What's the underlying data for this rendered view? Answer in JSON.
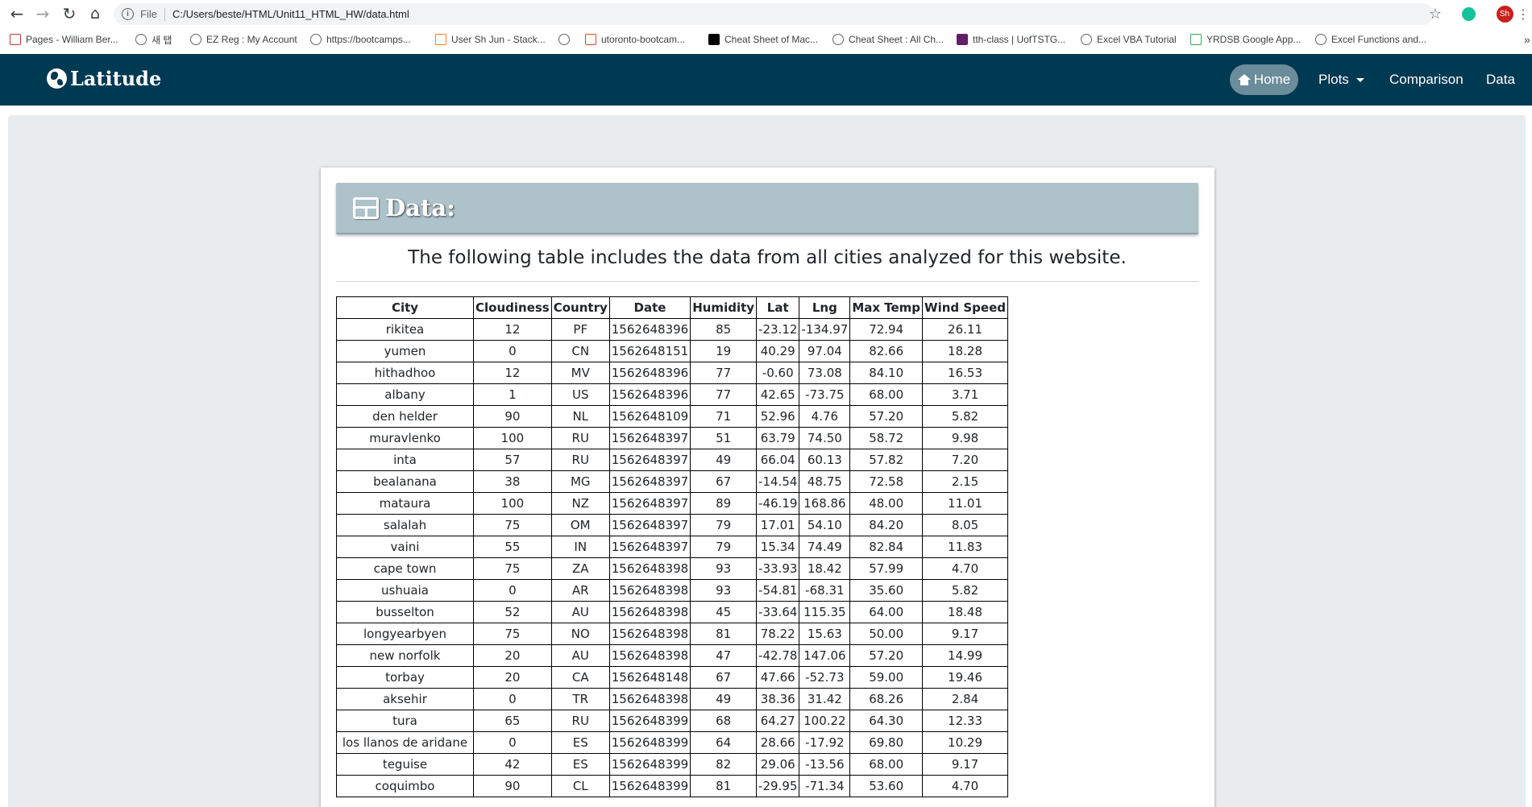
{
  "browser": {
    "address": {
      "scheme_label": "File",
      "url": "C:/Users/beste/HTML/Unit11_HTML_HW/data.html"
    },
    "profile_badge": "Sh",
    "bookmarks": [
      "Pages - William Ber...",
      "새 탭",
      "EZ Reg : My Account",
      "https://bootcamps...",
      "User Sh Jun - Stack...",
      "",
      "utoronto-bootcam...",
      "Cheat Sheet of Mac...",
      "Cheat Sheet : All Ch...",
      "tth-class | UofTSTG...",
      "Excel VBA Tutorial",
      "YRDSB Google App...",
      "Excel Functions and..."
    ],
    "bookmarks_overflow": "»"
  },
  "navbar": {
    "brand": "Latitude",
    "links": {
      "home": "Home",
      "plots": "Plots",
      "comparison": "Comparison",
      "data": "Data"
    }
  },
  "section": {
    "title": "Data:",
    "intro": "The following table includes the data from all cities analyzed for this website."
  },
  "table": {
    "headers": [
      "City",
      "Cloudiness",
      "Country",
      "Date",
      "Humidity",
      "Lat",
      "Lng",
      "Max Temp",
      "Wind Speed"
    ],
    "rows": [
      [
        "rikitea",
        "12",
        "PF",
        "1562648396",
        "85",
        "-23.12",
        "-134.97",
        "72.94",
        "26.11"
      ],
      [
        "yumen",
        "0",
        "CN",
        "1562648151",
        "19",
        "40.29",
        "97.04",
        "82.66",
        "18.28"
      ],
      [
        "hithadhoo",
        "12",
        "MV",
        "1562648396",
        "77",
        "-0.60",
        "73.08",
        "84.10",
        "16.53"
      ],
      [
        "albany",
        "1",
        "US",
        "1562648396",
        "77",
        "42.65",
        "-73.75",
        "68.00",
        "3.71"
      ],
      [
        "den helder",
        "90",
        "NL",
        "1562648109",
        "71",
        "52.96",
        "4.76",
        "57.20",
        "5.82"
      ],
      [
        "muravlenko",
        "100",
        "RU",
        "1562648397",
        "51",
        "63.79",
        "74.50",
        "58.72",
        "9.98"
      ],
      [
        "inta",
        "57",
        "RU",
        "1562648397",
        "49",
        "66.04",
        "60.13",
        "57.82",
        "7.20"
      ],
      [
        "bealanana",
        "38",
        "MG",
        "1562648397",
        "67",
        "-14.54",
        "48.75",
        "72.58",
        "2.15"
      ],
      [
        "mataura",
        "100",
        "NZ",
        "1562648397",
        "89",
        "-46.19",
        "168.86",
        "48.00",
        "11.01"
      ],
      [
        "salalah",
        "75",
        "OM",
        "1562648397",
        "79",
        "17.01",
        "54.10",
        "84.20",
        "8.05"
      ],
      [
        "vaini",
        "55",
        "IN",
        "1562648397",
        "79",
        "15.34",
        "74.49",
        "82.84",
        "11.83"
      ],
      [
        "cape town",
        "75",
        "ZA",
        "1562648398",
        "93",
        "-33.93",
        "18.42",
        "57.99",
        "4.70"
      ],
      [
        "ushuaia",
        "0",
        "AR",
        "1562648398",
        "93",
        "-54.81",
        "-68.31",
        "35.60",
        "5.82"
      ],
      [
        "busselton",
        "52",
        "AU",
        "1562648398",
        "45",
        "-33.64",
        "115.35",
        "64.00",
        "18.48"
      ],
      [
        "longyearbyen",
        "75",
        "NO",
        "1562648398",
        "81",
        "78.22",
        "15.63",
        "50.00",
        "9.17"
      ],
      [
        "new norfolk",
        "20",
        "AU",
        "1562648398",
        "47",
        "-42.78",
        "147.06",
        "57.20",
        "14.99"
      ],
      [
        "torbay",
        "20",
        "CA",
        "1562648148",
        "67",
        "47.66",
        "-52.73",
        "59.00",
        "19.46"
      ],
      [
        "aksehir",
        "0",
        "TR",
        "1562648398",
        "49",
        "38.36",
        "31.42",
        "68.26",
        "2.84"
      ],
      [
        "tura",
        "65",
        "RU",
        "1562648399",
        "68",
        "64.27",
        "100.22",
        "64.30",
        "12.33"
      ],
      [
        "los llanos de aridane",
        "0",
        "ES",
        "1562648399",
        "64",
        "28.66",
        "-17.92",
        "69.80",
        "10.29"
      ],
      [
        "teguise",
        "42",
        "ES",
        "1562648399",
        "82",
        "29.06",
        "-13.56",
        "68.00",
        "9.17"
      ],
      [
        "coquimbo",
        "90",
        "CL",
        "1562648399",
        "81",
        "-29.95",
        "-71.34",
        "53.60",
        "4.70"
      ]
    ]
  },
  "colors": {
    "navbar": "#003952",
    "header_band": "#aec2ca",
    "page_bg": "#e9ecef"
  }
}
